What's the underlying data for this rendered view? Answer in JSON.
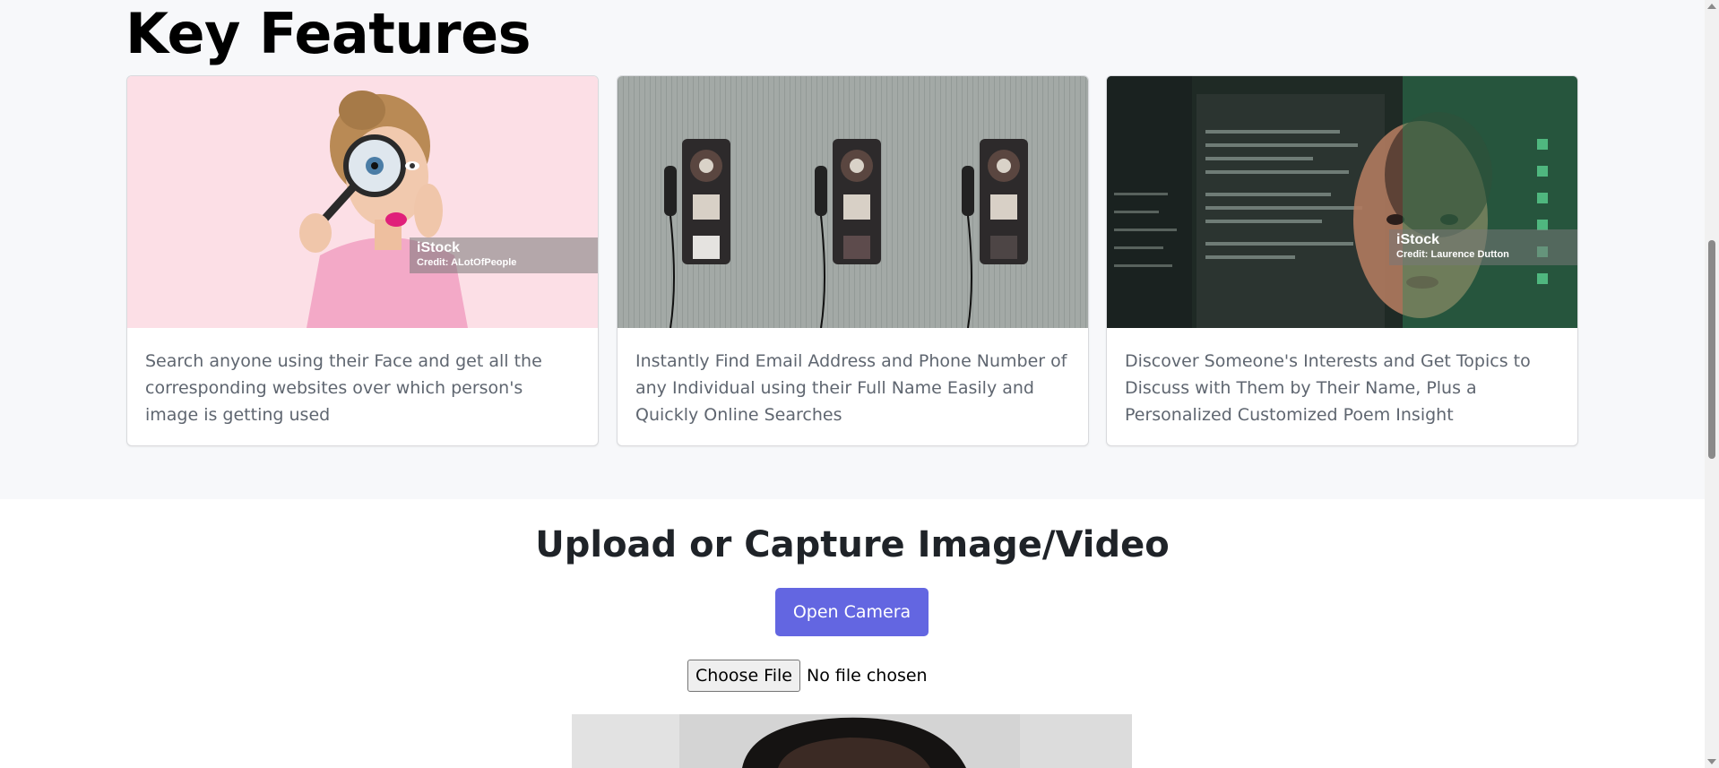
{
  "features": {
    "title": "Key Features",
    "cards": [
      {
        "image_desc": "woman-with-magnifying-glass",
        "watermark_brand": "iStock",
        "watermark_credit": "Credit: ALotOfPeople",
        "text": "Search anyone using their Face and get all the corresponding websites over which person's image is getting used"
      },
      {
        "image_desc": "payphones-on-wall",
        "text": "Instantly Find Email Address and Phone Number of any Individual using their Full Name Easily and Quickly Online Searches"
      },
      {
        "image_desc": "woman-with-ai-screen",
        "watermark_brand": "iStock",
        "watermark_credit": "Credit: Laurence Dutton",
        "text": "Discover Someone's Interests and Get Topics to Discuss with Them by Their Name, Plus a Personalized Customized Poem Insight"
      }
    ]
  },
  "upload": {
    "title": "Upload or Capture Image/Video",
    "open_camera_label": "Open Camera",
    "choose_file_label": "Choose File",
    "file_status": "No file chosen"
  },
  "colors": {
    "accent": "#6366e1",
    "section_bg": "#f7f8fa",
    "body_text": "#5f6670"
  }
}
